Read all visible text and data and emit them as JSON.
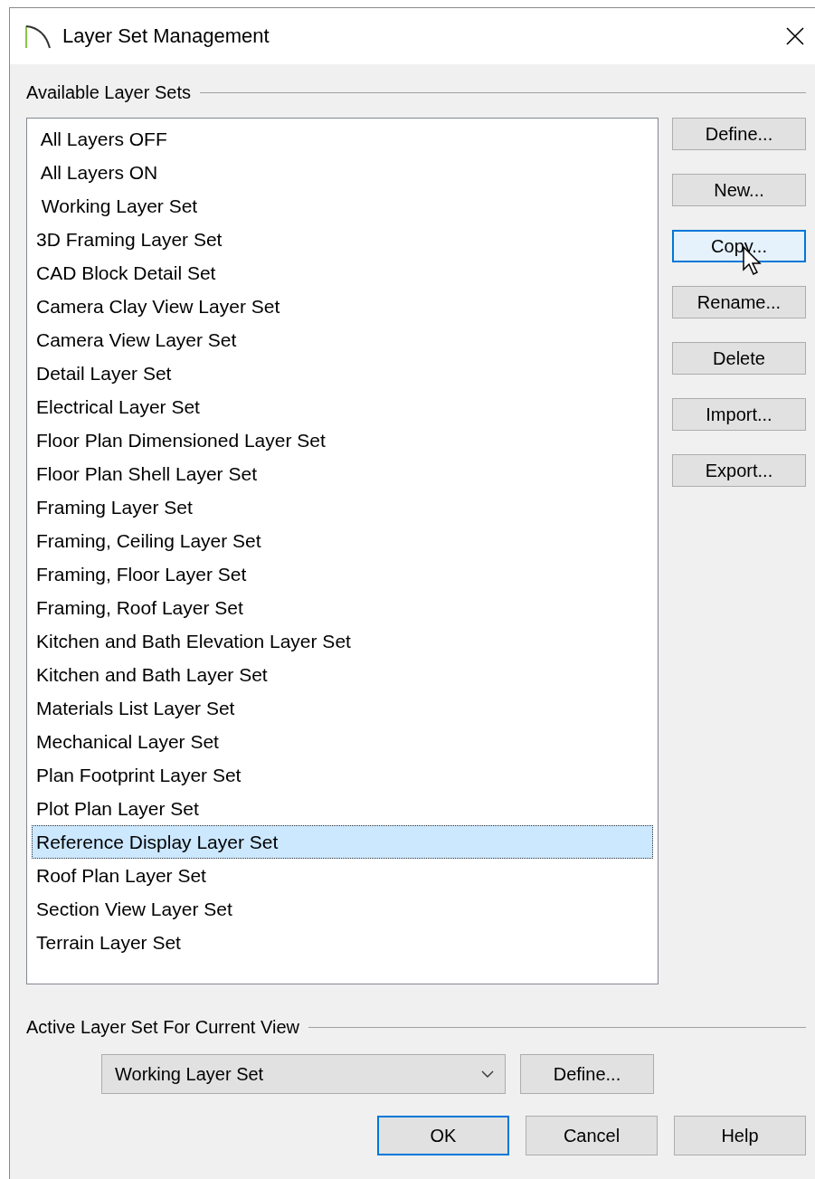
{
  "window": {
    "title": "Layer Set Management"
  },
  "available": {
    "label": "Available Layer Sets",
    "items": [
      {
        "label": " All Layers OFF",
        "selected": false
      },
      {
        "label": " All Layers ON",
        "selected": false
      },
      {
        "label": " Working Layer Set",
        "selected": false
      },
      {
        "label": "3D Framing Layer Set",
        "selected": false
      },
      {
        "label": "CAD Block Detail Set",
        "selected": false
      },
      {
        "label": "Camera Clay View Layer Set",
        "selected": false
      },
      {
        "label": "Camera View Layer Set",
        "selected": false
      },
      {
        "label": "Detail Layer Set",
        "selected": false
      },
      {
        "label": "Electrical Layer Set",
        "selected": false
      },
      {
        "label": "Floor Plan Dimensioned Layer Set",
        "selected": false
      },
      {
        "label": "Floor Plan Shell Layer Set",
        "selected": false
      },
      {
        "label": "Framing Layer Set",
        "selected": false
      },
      {
        "label": "Framing, Ceiling Layer Set",
        "selected": false
      },
      {
        "label": "Framing, Floor Layer Set",
        "selected": false
      },
      {
        "label": "Framing, Roof Layer Set",
        "selected": false
      },
      {
        "label": "Kitchen and Bath Elevation Layer Set",
        "selected": false
      },
      {
        "label": "Kitchen and Bath Layer Set",
        "selected": false
      },
      {
        "label": "Materials List Layer Set",
        "selected": false
      },
      {
        "label": "Mechanical Layer Set",
        "selected": false
      },
      {
        "label": "Plan Footprint Layer Set",
        "selected": false
      },
      {
        "label": "Plot Plan Layer Set",
        "selected": false
      },
      {
        "label": "Reference Display Layer Set",
        "selected": true
      },
      {
        "label": "Roof Plan Layer Set",
        "selected": false
      },
      {
        "label": "Section View Layer Set",
        "selected": false
      },
      {
        "label": "Terrain Layer Set",
        "selected": false
      }
    ],
    "buttons": [
      {
        "label": "Define...",
        "hovered": false
      },
      {
        "label": "New...",
        "hovered": false
      },
      {
        "label": "Copy...",
        "hovered": true
      },
      {
        "label": "Rename...",
        "hovered": false
      },
      {
        "label": "Delete",
        "hovered": false
      },
      {
        "label": "Import...",
        "hovered": false
      },
      {
        "label": "Export...",
        "hovered": false
      }
    ]
  },
  "active": {
    "label": "Active Layer Set For Current View",
    "value": "Working Layer Set",
    "define_button": "Define..."
  },
  "footer_buttons": [
    {
      "label": "OK",
      "default": true
    },
    {
      "label": "Cancel",
      "default": false
    },
    {
      "label": "Help",
      "default": false
    }
  ]
}
